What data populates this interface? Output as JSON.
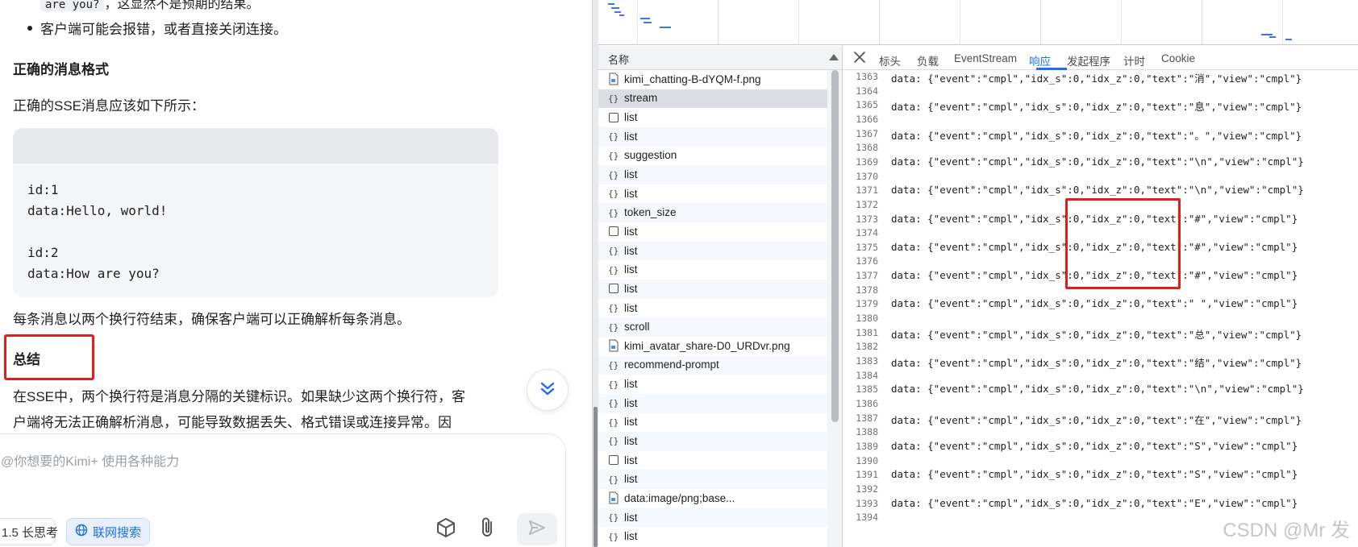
{
  "chat": {
    "cut_line_code": "are you?",
    "cut_line_text": "，这显然不是预期的结果。",
    "bullet": "客户端可能会报错，或者直接关闭连接。",
    "heading_format": "正确的消息格式",
    "intro": "正确的SSE消息应该如下所示：",
    "code_block": "id:1\ndata:Hello, world!\n\nid:2\ndata:How are you?",
    "note": "每条消息以两个换行符结束，确保客户端可以正确解析每条消息。",
    "heading_summary": "总结",
    "summary_line1": "在SSE中，两个换行符是消息分隔的关键标识。如果缺少这两个换行符，客",
    "summary_line2": "户端将无法正确解析消息，可能导致数据丢失、格式错误或连接异常。因",
    "input_placeholder": "@你想要的Kimi+ 使用各种能力",
    "chip_think": "1.5 长思考",
    "chip_search": "联网搜索",
    "accent": "#1a6ee8",
    "highlight": "#e02020"
  },
  "devtools": {
    "names_header": "名称",
    "requests": [
      {
        "name": "kimi_chatting-B-dYQM-f.png",
        "icon": "image-file-icon"
      },
      {
        "name": "stream",
        "icon": "fetch-icon",
        "selected": true
      },
      {
        "name": "list",
        "icon": "document-icon"
      },
      {
        "name": "list",
        "icon": "fetch-icon"
      },
      {
        "name": "suggestion",
        "icon": "fetch-icon"
      },
      {
        "name": "list",
        "icon": "fetch-icon"
      },
      {
        "name": "list",
        "icon": "fetch-icon"
      },
      {
        "name": "token_size",
        "icon": "fetch-icon"
      },
      {
        "name": "list",
        "icon": "document-icon"
      },
      {
        "name": "list",
        "icon": "fetch-icon"
      },
      {
        "name": "list",
        "icon": "fetch-icon"
      },
      {
        "name": "list",
        "icon": "document-icon"
      },
      {
        "name": "list",
        "icon": "fetch-icon"
      },
      {
        "name": "scroll",
        "icon": "fetch-icon"
      },
      {
        "name": "kimi_avatar_share-D0_URDvr.png",
        "icon": "image-file-icon"
      },
      {
        "name": "recommend-prompt",
        "icon": "fetch-icon"
      },
      {
        "name": "list",
        "icon": "fetch-icon"
      },
      {
        "name": "list",
        "icon": "fetch-icon"
      },
      {
        "name": "list",
        "icon": "fetch-icon"
      },
      {
        "name": "list",
        "icon": "fetch-icon"
      },
      {
        "name": "list",
        "icon": "document-icon"
      },
      {
        "name": "list",
        "icon": "fetch-icon"
      },
      {
        "name": "data:image/png;base...",
        "icon": "image-file-icon"
      },
      {
        "name": "list",
        "icon": "fetch-icon"
      },
      {
        "name": "list",
        "icon": "fetch-icon"
      }
    ],
    "tabs": [
      {
        "label": "标头",
        "active": false
      },
      {
        "label": "负载",
        "active": false
      },
      {
        "label": "EventStream",
        "active": false
      },
      {
        "label": "响应",
        "active": true
      },
      {
        "label": "发起程序",
        "active": false
      },
      {
        "label": "计时",
        "active": false
      },
      {
        "label": "Cookie",
        "active": false
      }
    ],
    "response_lines": [
      {
        "n": "1363",
        "text": "data: {\"event\":\"cmpl\",\"idx_s\":0,\"idx_z\":0,\"text\":\"消\",\"view\":\"cmpl\"}"
      },
      {
        "n": "1364",
        "text": ""
      },
      {
        "n": "1365",
        "text": "data: {\"event\":\"cmpl\",\"idx_s\":0,\"idx_z\":0,\"text\":\"息\",\"view\":\"cmpl\"}"
      },
      {
        "n": "1366",
        "text": ""
      },
      {
        "n": "1367",
        "text": "data: {\"event\":\"cmpl\",\"idx_s\":0,\"idx_z\":0,\"text\":\"。\",\"view\":\"cmpl\"}"
      },
      {
        "n": "1368",
        "text": ""
      },
      {
        "n": "1369",
        "text": "data: {\"event\":\"cmpl\",\"idx_s\":0,\"idx_z\":0,\"text\":\"\\n\",\"view\":\"cmpl\"}"
      },
      {
        "n": "1370",
        "text": ""
      },
      {
        "n": "1371",
        "text": "data: {\"event\":\"cmpl\",\"idx_s\":0,\"idx_z\":0,\"text\":\"\\n\",\"view\":\"cmpl\"}"
      },
      {
        "n": "1372",
        "text": ""
      },
      {
        "n": "1373",
        "text": "data: {\"event\":\"cmpl\",\"idx_s\":0,\"idx_z\":0,\"text\":\"#\",\"view\":\"cmpl\"}"
      },
      {
        "n": "1374",
        "text": ""
      },
      {
        "n": "1375",
        "text": "data: {\"event\":\"cmpl\",\"idx_s\":0,\"idx_z\":0,\"text\":\"#\",\"view\":\"cmpl\"}"
      },
      {
        "n": "1376",
        "text": ""
      },
      {
        "n": "1377",
        "text": "data: {\"event\":\"cmpl\",\"idx_s\":0,\"idx_z\":0,\"text\":\"#\",\"view\":\"cmpl\"}"
      },
      {
        "n": "1378",
        "text": ""
      },
      {
        "n": "1379",
        "text": "data: {\"event\":\"cmpl\",\"idx_s\":0,\"idx_z\":0,\"text\":\" \",\"view\":\"cmpl\"}"
      },
      {
        "n": "1380",
        "text": ""
      },
      {
        "n": "1381",
        "text": "data: {\"event\":\"cmpl\",\"idx_s\":0,\"idx_z\":0,\"text\":\"总\",\"view\":\"cmpl\"}"
      },
      {
        "n": "1382",
        "text": ""
      },
      {
        "n": "1383",
        "text": "data: {\"event\":\"cmpl\",\"idx_s\":0,\"idx_z\":0,\"text\":\"结\",\"view\":\"cmpl\"}"
      },
      {
        "n": "1384",
        "text": ""
      },
      {
        "n": "1385",
        "text": "data: {\"event\":\"cmpl\",\"idx_s\":0,\"idx_z\":0,\"text\":\"\\n\",\"view\":\"cmpl\"}"
      },
      {
        "n": "1386",
        "text": ""
      },
      {
        "n": "1387",
        "text": "data: {\"event\":\"cmpl\",\"idx_s\":0,\"idx_z\":0,\"text\":\"在\",\"view\":\"cmpl\"}"
      },
      {
        "n": "1388",
        "text": ""
      },
      {
        "n": "1389",
        "text": "data: {\"event\":\"cmpl\",\"idx_s\":0,\"idx_z\":0,\"text\":\"S\",\"view\":\"cmpl\"}"
      },
      {
        "n": "1390",
        "text": ""
      },
      {
        "n": "1391",
        "text": "data: {\"event\":\"cmpl\",\"idx_s\":0,\"idx_z\":0,\"text\":\"S\",\"view\":\"cmpl\"}"
      },
      {
        "n": "1392",
        "text": ""
      },
      {
        "n": "1393",
        "text": "data: {\"event\":\"cmpl\",\"idx_s\":0,\"idx_z\":0,\"text\":\"E\",\"view\":\"cmpl\"}"
      },
      {
        "n": "1394",
        "text": ""
      }
    ],
    "watermark": "CSDN @Mr 发"
  }
}
